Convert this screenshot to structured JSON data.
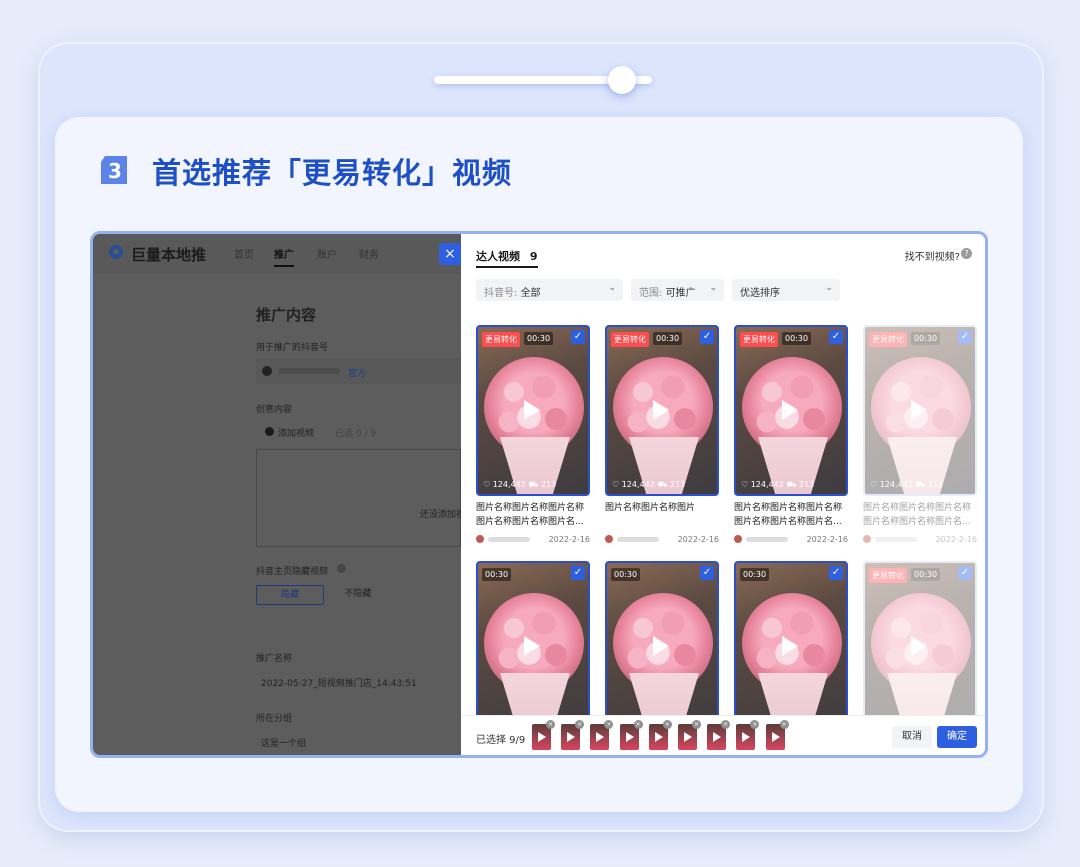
{
  "step": {
    "number": "3",
    "title": "首选推荐「更易转化」视频"
  },
  "colors": {
    "accent": "#2d5fe0",
    "title": "#1d4fc8",
    "tag": "#ff4d4f"
  },
  "left_panel": {
    "brand": "巨量本地推",
    "nav": [
      "首页",
      "推广",
      "账户",
      "财务"
    ],
    "close_icon": "×",
    "section_title": "推广内容",
    "douyin_label": "用于推广的抖音号",
    "douyin_tag": "官方",
    "creative_label": "创意内容",
    "add_video": "添加视频",
    "selected_count": "已选 0 / 9",
    "empty_text": "还没添加视",
    "hide_label": "抖音主页隐藏视频",
    "hide_options": [
      "隐藏",
      "不隐藏"
    ],
    "name_label": "推广名称",
    "name_value": "2022-05-27_短视频推门店_14:43:51",
    "group_label": "所在分组",
    "group_value": "这是一个组"
  },
  "right_panel": {
    "tab_label": "达人视频",
    "tab_count": "9",
    "help_text": "找不到视频?",
    "filters": [
      {
        "label": "抖音号:",
        "value": "全部"
      },
      {
        "label": "范围:",
        "value": "可推广"
      },
      {
        "label": "",
        "value": "优选排序"
      }
    ],
    "videos": [
      {
        "tag": "更易转化",
        "duration": "00:30",
        "likes": "124,442",
        "carts": "213",
        "title": "图片名称图片名称图片名称图片名称图片名称图片名...",
        "date": "2022-2-16",
        "faded": false
      },
      {
        "tag": "更易转化",
        "duration": "00:30",
        "likes": "124,442",
        "carts": "213",
        "title": "图片名称图片名称图片",
        "date": "2022-2-16",
        "faded": false
      },
      {
        "tag": "更易转化",
        "duration": "00:30",
        "likes": "124,442",
        "carts": "213",
        "title": "图片名称图片名称图片名称图片名称图片名称图片名...",
        "date": "2022-2-16",
        "faded": false
      },
      {
        "tag": "更易转化",
        "duration": "00:30",
        "likes": "124,442",
        "carts": "213",
        "title": "图片名称图片名称图片名称图片名称图片名称图片名...",
        "date": "2022-2-16",
        "faded": true
      },
      {
        "tag": "",
        "duration": "00:30",
        "likes": "",
        "carts": "",
        "title": "",
        "date": "",
        "faded": false
      },
      {
        "tag": "",
        "duration": "00:30",
        "likes": "",
        "carts": "",
        "title": "",
        "date": "",
        "faded": false
      },
      {
        "tag": "",
        "duration": "00:30",
        "likes": "",
        "carts": "",
        "title": "",
        "date": "",
        "faded": false
      },
      {
        "tag": "更易转化",
        "duration": "00:30",
        "likes": "",
        "carts": "",
        "title": "",
        "date": "",
        "faded": true
      }
    ],
    "selected_text": "已选择 9/9",
    "selected_thumbnail_count": 9,
    "cancel": "取消",
    "confirm": "确定"
  }
}
